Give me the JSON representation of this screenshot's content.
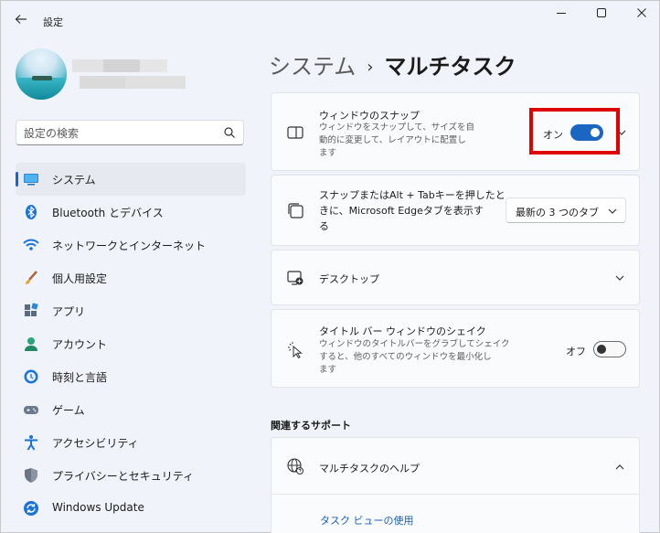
{
  "window": {
    "title": "設定",
    "minimize": "—",
    "maximize": "☐",
    "close": "✕"
  },
  "search": {
    "placeholder": "設定の検索"
  },
  "sidebar": {
    "items": [
      {
        "label": "システム",
        "icon": "system-icon",
        "active": true
      },
      {
        "label": "Bluetooth とデバイス",
        "icon": "bluetooth-icon"
      },
      {
        "label": "ネットワークとインターネット",
        "icon": "wifi-icon"
      },
      {
        "label": "個人用設定",
        "icon": "brush-icon"
      },
      {
        "label": "アプリ",
        "icon": "apps-icon"
      },
      {
        "label": "アカウント",
        "icon": "account-icon"
      },
      {
        "label": "時刻と言語",
        "icon": "clock-globe-icon"
      },
      {
        "label": "ゲーム",
        "icon": "gamepad-icon"
      },
      {
        "label": "アクセシビリティ",
        "icon": "accessibility-icon"
      },
      {
        "label": "プライバシーとセキュリティ",
        "icon": "shield-icon"
      },
      {
        "label": "Windows Update",
        "icon": "update-icon"
      }
    ]
  },
  "breadcrumb": {
    "parent": "システム",
    "separator": "›",
    "current": "マルチタスク"
  },
  "cards": {
    "snap": {
      "title": "ウィンドウのスナップ",
      "desc_lines": [
        "ウィンドウをスナップして、サイズを自",
        "動的に変更して、レイアウトに配置し",
        "ます"
      ],
      "toggle_label": "オン",
      "toggle_on": true
    },
    "alt_tab": {
      "title_lines": [
        "スナップまたはAlt + Tabキーを押したと",
        "きに、Microsoft Edgeタブを表示す",
        "る"
      ],
      "dropdown_value": "最新の 3 つのタブ"
    },
    "desktops": {
      "title": "デスクトップ"
    },
    "shake": {
      "title": "タイトル バー ウィンドウのシェイク",
      "desc_lines": [
        "ウィンドウのタイトルバーをグラブしてシェイク",
        "すると、他のすべてのウィンドウを最小化し",
        "ます"
      ],
      "toggle_label": "オフ",
      "toggle_on": false
    }
  },
  "related": {
    "heading": "関連するサポート",
    "help_title": "マルチタスクのヘルプ",
    "link": "タスク ビューの使用"
  },
  "colors": {
    "accent": "#1a66c2",
    "highlight": "#e00000"
  }
}
